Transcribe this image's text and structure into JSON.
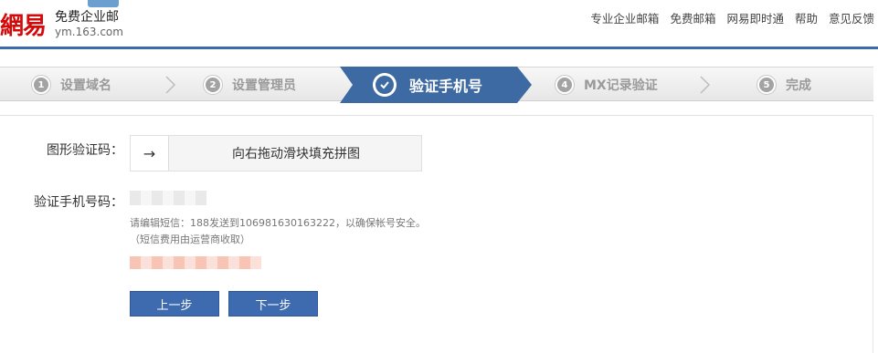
{
  "header": {
    "logo_mark": "網易",
    "product": "免费企业邮",
    "domain": "ym.163.com",
    "nav": [
      "专业企业邮箱",
      "免费邮箱",
      "网易即时通",
      "帮助",
      "意见反馈"
    ]
  },
  "steps": [
    {
      "num": "1",
      "label": "设置域名",
      "state": "done"
    },
    {
      "num": "2",
      "label": "设置管理员",
      "state": "done"
    },
    {
      "num": "3",
      "label": "验证手机号",
      "state": "active"
    },
    {
      "num": "4",
      "label": "MX记录验证",
      "state": "todo"
    },
    {
      "num": "5",
      "label": "完成",
      "state": "todo"
    }
  ],
  "form": {
    "captcha_label": "图形验证码：",
    "captcha_arrow": "→",
    "captcha_hint": "向右拖动滑块填充拼图",
    "phone_label": "验证手机号码：",
    "sms_note_line1": "请编辑短信：188发送到106981630163222，以确保帐号安全。",
    "sms_note_line2": "（短信费用由运营商收取）",
    "prev_button": "上一步",
    "next_button": "下一步"
  },
  "colors": {
    "brand_red": "#d40a0a",
    "active_step": "#3e6aa3",
    "button": "#3e6bb0",
    "rule": "#3b6aa8"
  }
}
